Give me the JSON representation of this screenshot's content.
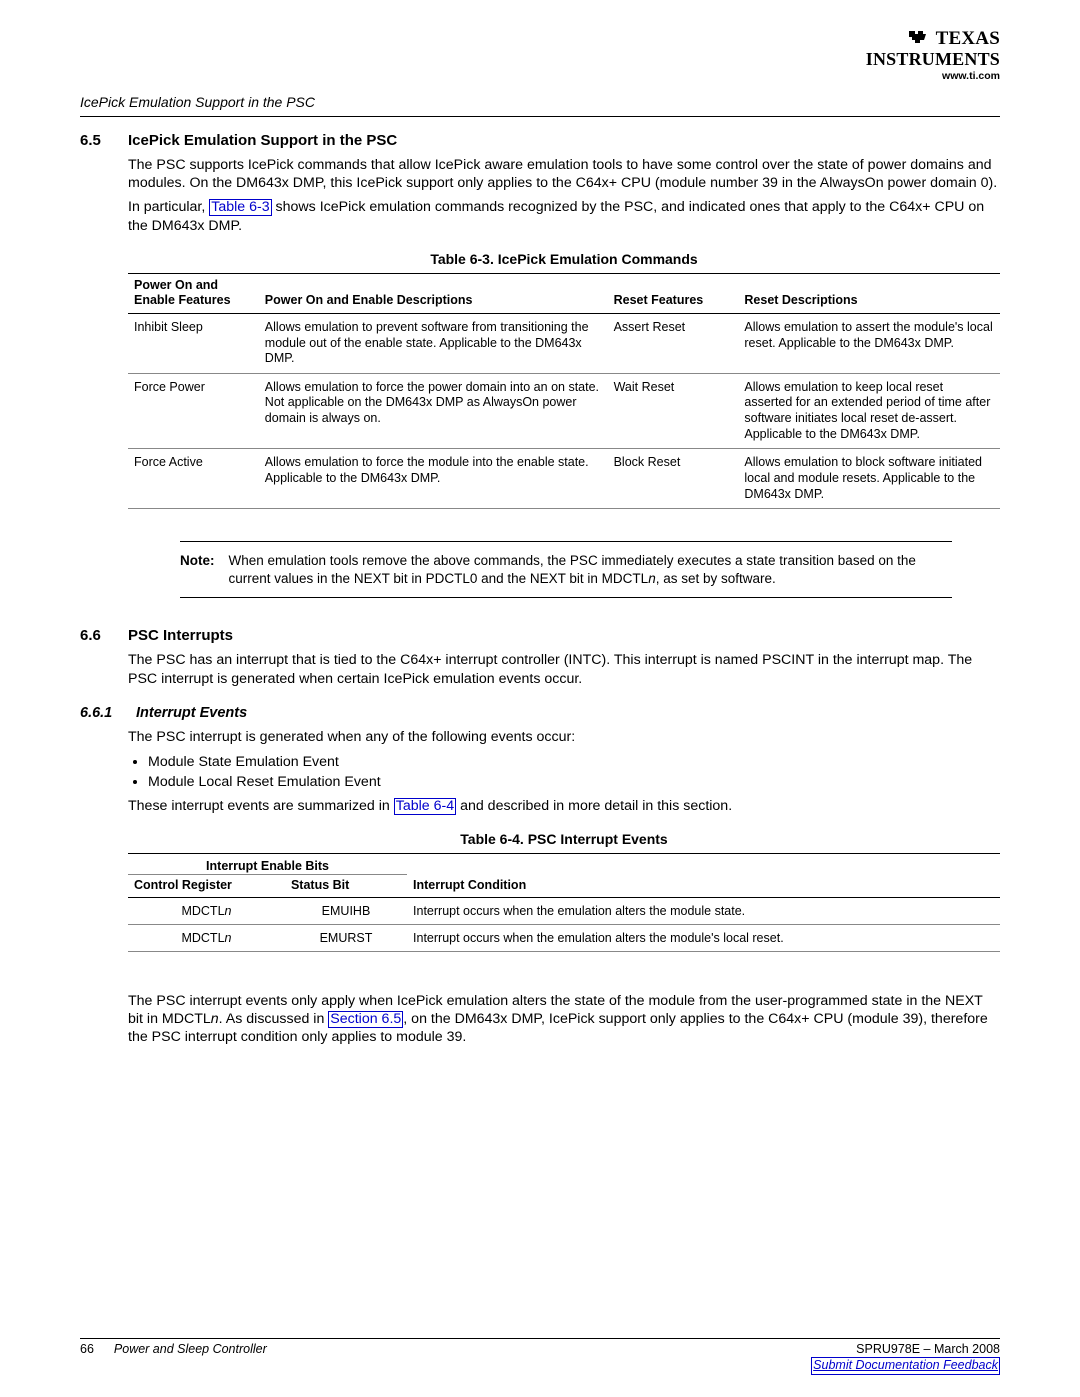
{
  "brand": {
    "name_line1": "TEXAS",
    "name_line2": "INSTRUMENTS",
    "url": "www.ti.com"
  },
  "running_header": "IcePick Emulation Support in the PSC",
  "sections": {
    "s65": {
      "num": "6.5",
      "title": "IcePick Emulation Support in the PSC",
      "para1": "The PSC supports IcePick commands that allow IcePick aware emulation tools to have some control over the state of power domains and modules. On the DM643x DMP, this IcePick support only applies to the C64x+ CPU (module number 39 in the AlwaysOn power domain 0).",
      "para2a": "In particular, ",
      "para2_link": "Table 6-3",
      "para2b": " shows IcePick emulation commands recognized by the PSC, and indicated ones that apply to the C64x+ CPU on the DM643x DMP."
    },
    "s66": {
      "num": "6.6",
      "title": "PSC Interrupts",
      "para": "The PSC has an interrupt that is tied to the C64x+ interrupt controller (INTC). This interrupt is named PSCINT in the interrupt map. The PSC interrupt is generated when certain IcePick emulation events occur."
    },
    "s661": {
      "num": "6.6.1",
      "title": "Interrupt Events",
      "para_intro": "The PSC interrupt is generated when any of the following events occur:",
      "bullets": [
        "Module State Emulation Event",
        "Module Local Reset Emulation Event"
      ],
      "para_post_a": "These interrupt events are summarized in ",
      "para_post_link": "Table 6-4",
      "para_post_b": " and described in more detail in this section.",
      "para_last_a": "The PSC interrupt events only apply when IcePick emulation alters the state of the module from the user-programmed state in the NEXT bit in MDCTL",
      "para_last_b": ". As discussed in ",
      "para_last_link": "Section 6.5",
      "para_last_c": ", on the DM643x DMP, IcePick support only applies to the C64x+ CPU (module 39), therefore the PSC interrupt condition only applies to module 39."
    }
  },
  "table63": {
    "caption": "Table 6-3. IcePick Emulation Commands",
    "head": {
      "col1a": "Power On and",
      "col1b": "Enable Features",
      "col2": "Power On and Enable Descriptions",
      "col3": "Reset Features",
      "col4": "Reset Descriptions"
    },
    "rows": [
      {
        "f": "Inhibit Sleep",
        "d": "Allows emulation to prevent software from transitioning the module out of the enable state. Applicable to the DM643x DMP.",
        "rf": "Assert Reset",
        "rd": "Allows emulation to assert the module's local reset. Applicable to the DM643x DMP."
      },
      {
        "f": "Force Power",
        "d": "Allows emulation to force the power domain into an on state. Not applicable on the DM643x DMP as AlwaysOn power domain is always on.",
        "rf": "Wait Reset",
        "rd": "Allows emulation to keep local reset asserted for an extended period of time after software initiates local reset de-assert. Applicable to the DM643x DMP."
      },
      {
        "f": "Force Active",
        "d": "Allows emulation to force the module into the enable state. Applicable to the DM643x DMP.",
        "rf": "Block Reset",
        "rd": "Allows emulation to block software initiated local and module resets. Applicable to the DM643x DMP."
      }
    ]
  },
  "note": {
    "label": "Note:",
    "text_a": "When emulation tools remove the above commands, the PSC immediately executes a state transition based on the current values in the NEXT bit in PDCTL0 and the NEXT bit in MDCTL",
    "text_b": ", as set by software."
  },
  "table64": {
    "caption": "Table 6-4. PSC Interrupt Events",
    "head": {
      "span": "Interrupt Enable Bits",
      "col1": "Control Register",
      "col2": "Status Bit",
      "col3": "Interrupt Condition"
    },
    "rows": [
      {
        "cr_a": "MDCTL",
        "sb": "EMUIHB",
        "cond": "Interrupt occurs when the emulation alters the module state."
      },
      {
        "cr_a": "MDCTL",
        "sb": "EMURST",
        "cond": "Interrupt occurs when the emulation alters the module's local reset."
      }
    ]
  },
  "footer": {
    "page": "66",
    "chapter": "Power and Sleep Controller",
    "docid": "SPRU978E – March 2008",
    "feedback": "Submit Documentation Feedback"
  },
  "italic_n": "n"
}
